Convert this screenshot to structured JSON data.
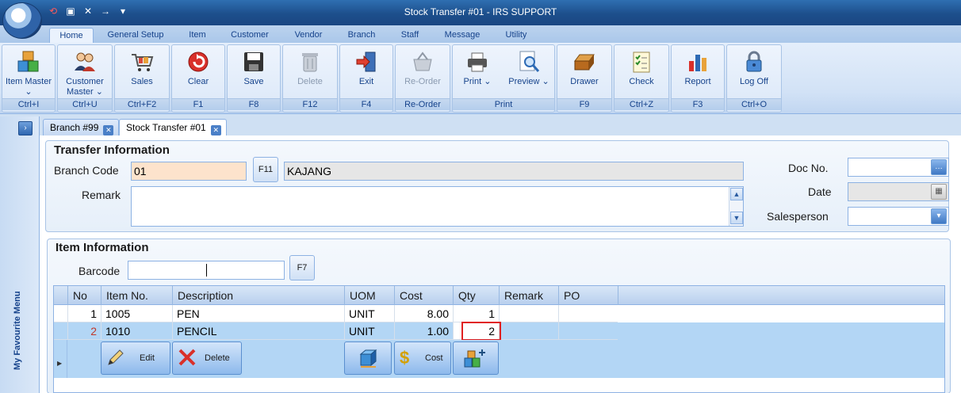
{
  "window": {
    "title": "Stock Transfer #01 - IRS SUPPORT"
  },
  "ribbon_tabs": [
    "Home",
    "General Setup",
    "Item",
    "Customer",
    "Vendor",
    "Branch",
    "Staff",
    "Message",
    "Utility"
  ],
  "ribbon_groups": [
    {
      "buttons": [
        {
          "label": "Item Master ⌄",
          "icon": "cubes-icon"
        }
      ],
      "shortcut": "Ctrl+I"
    },
    {
      "buttons": [
        {
          "label": "Customer Master ⌄",
          "icon": "users-icon"
        }
      ],
      "shortcut": "Ctrl+U"
    },
    {
      "buttons": [
        {
          "label": "Sales",
          "icon": "cart-icon"
        }
      ],
      "shortcut": "Ctrl+F2"
    },
    {
      "buttons": [
        {
          "label": "Clear",
          "icon": "clear-icon"
        }
      ],
      "shortcut": "F1"
    },
    {
      "buttons": [
        {
          "label": "Save",
          "icon": "floppy-icon"
        }
      ],
      "shortcut": "F8"
    },
    {
      "buttons": [
        {
          "label": "Delete",
          "icon": "trash-icon",
          "disabled": true
        }
      ],
      "shortcut": "F12"
    },
    {
      "buttons": [
        {
          "label": "Exit",
          "icon": "exit-door-icon"
        }
      ],
      "shortcut": "F4"
    },
    {
      "buttons": [
        {
          "label": "Re-Order",
          "icon": "basket-icon",
          "disabled": true
        }
      ],
      "shortcut": "Re-Order"
    },
    {
      "buttons": [
        {
          "label": "Print ⌄",
          "icon": "printer-icon"
        },
        {
          "label": "Preview ⌄",
          "icon": "magnifier-icon"
        }
      ],
      "shortcut": "Print"
    },
    {
      "buttons": [
        {
          "label": "Drawer",
          "icon": "drawer-icon"
        }
      ],
      "shortcut": "F9"
    },
    {
      "buttons": [
        {
          "label": "Check",
          "icon": "checklist-icon"
        }
      ],
      "shortcut": "Ctrl+Z"
    },
    {
      "buttons": [
        {
          "label": "Report",
          "icon": "bar-chart-icon"
        }
      ],
      "shortcut": "F3"
    },
    {
      "buttons": [
        {
          "label": "Log Off",
          "icon": "padlock-icon"
        }
      ],
      "shortcut": "Ctrl+O"
    }
  ],
  "left_panel": {
    "label": "My Favourite Menu",
    "toggle": "›"
  },
  "doc_tabs": [
    {
      "label": "Branch #99"
    },
    {
      "label": "Stock Transfer #01"
    }
  ],
  "transfer": {
    "title": "Transfer Information",
    "branch_code_label": "Branch Code",
    "branch_code": "01",
    "lookup_label": "F11",
    "branch_name": "KAJANG",
    "remark_label": "Remark",
    "remark": "",
    "doc_no_label": "Doc No.",
    "doc_no": "",
    "date_label": "Date",
    "date": "",
    "salesperson_label": "Salesperson",
    "salesperson": ""
  },
  "item_info": {
    "title": "Item Information",
    "barcode_label": "Barcode",
    "barcode": "",
    "lookup_label": "F7"
  },
  "grid": {
    "columns": [
      "No",
      "Item No.",
      "Description",
      "UOM",
      "Cost",
      "Qty",
      "Remark",
      "PO"
    ],
    "rows": [
      {
        "no": "1",
        "item_no": "1005",
        "description": "PEN",
        "uom": "UNIT",
        "cost": "8.00",
        "qty": "1",
        "remark": "",
        "po": ""
      },
      {
        "no": "2",
        "item_no": "1010",
        "description": "PENCIL",
        "uom": "UNIT",
        "cost": "1.00",
        "qty": "2",
        "remark": "",
        "po": ""
      }
    ],
    "actions": {
      "edit": "Edit",
      "delete": "Delete",
      "cost": "Cost"
    }
  },
  "colors": {
    "accent": "#2f6fb1",
    "selected_row": "#b3d6f5",
    "highlight_box": "#e02020",
    "branch_code_bg": "#fde3cc"
  }
}
